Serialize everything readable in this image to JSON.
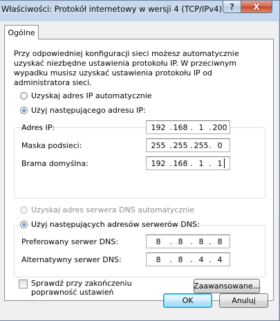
{
  "window": {
    "title": "Właściwości: Protokół internetowy w wersji 4 (TCP/IPv4)",
    "help_glyph": "?",
    "close_glyph": "X"
  },
  "tabs": [
    {
      "label": "Ogólne",
      "selected": true
    }
  ],
  "intro": "Przy odpowiedniej konfiguracji sieci możesz automatycznie uzyskać niezbędne ustawienia protokołu IP. W przeciwnym wypadku musisz uzyskać ustawienia protokołu IP od administratora sieci.",
  "ip": {
    "auto_label": "Uzyskaj adres IP automatycznie",
    "manual_label": "Użyj następującego adresu IP:",
    "mode": "manual",
    "fields": [
      {
        "label": "Adres IP:",
        "octets": [
          "192",
          "168",
          "1",
          "200"
        ]
      },
      {
        "label": "Maska podsieci:",
        "octets": [
          "255",
          "255",
          "255",
          "0"
        ]
      },
      {
        "label": "Brama domyślna:",
        "octets": [
          "192",
          "168",
          "1",
          "1"
        ]
      }
    ]
  },
  "dns": {
    "auto_label": "Uzyskaj adres serwera DNS automatycznie",
    "auto_enabled": false,
    "manual_label": "Użyj następujących adresów serwerów DNS:",
    "mode": "manual",
    "fields": [
      {
        "label": "Preferowany serwer DNS:",
        "octets": [
          "8",
          "8",
          "8",
          "8"
        ]
      },
      {
        "label": "Alternatywny serwer DNS:",
        "octets": [
          "8",
          "8",
          "4",
          "4"
        ]
      }
    ]
  },
  "validate": {
    "label": "Sprawdź przy zakończeniu poprawność ustawień",
    "checked": false
  },
  "buttons": {
    "advanced": "Zaawansowane...",
    "ok": "OK",
    "cancel": "Anuluj"
  }
}
